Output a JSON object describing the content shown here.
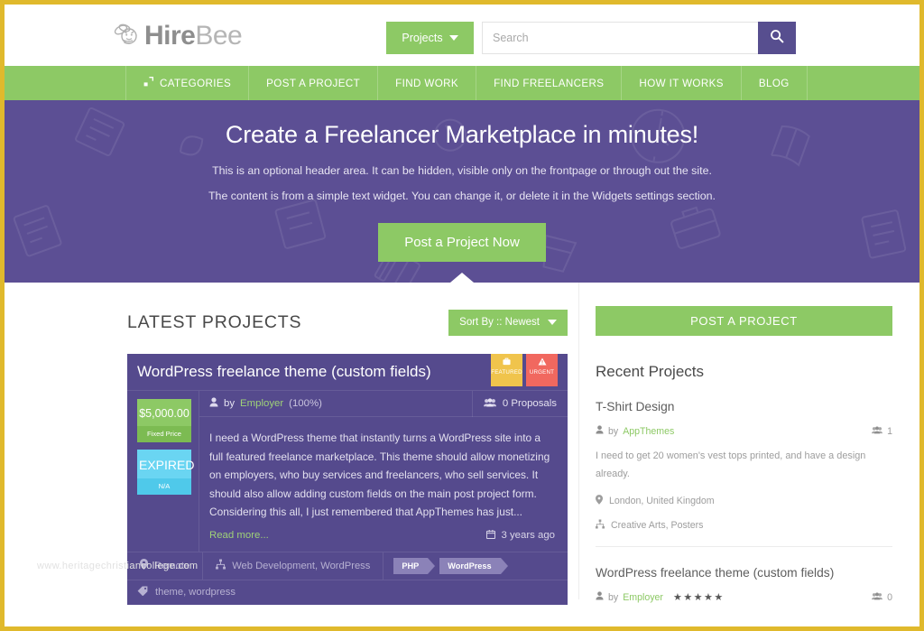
{
  "theme": {
    "page_border": "#e0b92c",
    "green": "#8dc965",
    "purple": "#5c4f94",
    "card_purple": "#554a8d",
    "search_btn": "#574e8f",
    "featured": "#f0c44c",
    "urgent": "#f1685f",
    "price_badge": "#8dc965",
    "status_badge": "#6ad5f2"
  },
  "header": {
    "logo_primary": "Hire",
    "logo_secondary": "Bee",
    "logo_icon": "bee-icon",
    "projects_dropdown": "Projects",
    "projects_caret_icon": "chevron-down-icon",
    "search_placeholder": "Search",
    "search_value": "",
    "search_icon": "search-icon"
  },
  "nav": {
    "items": [
      {
        "label": "CATEGORIES",
        "icon": "categories-icon"
      },
      {
        "label": "POST A PROJECT",
        "icon": ""
      },
      {
        "label": "FIND WORK",
        "icon": ""
      },
      {
        "label": "FIND FREELANCERS",
        "icon": ""
      },
      {
        "label": "HOW IT WORKS",
        "icon": ""
      },
      {
        "label": "BLOG",
        "icon": ""
      }
    ]
  },
  "hero": {
    "title": "Create a Freelancer Marketplace in minutes!",
    "line1": "This is an optional header area. It can be hidden, visible only on the frontpage or through out the site.",
    "line2": "The content is from a simple text widget. You can change it, or delete it in the Widgets settings section.",
    "button": "Post a Project Now"
  },
  "main": {
    "section_title": "LATEST PROJECTS",
    "sort_label": "Sort By :: Newest",
    "sort_caret_icon": "chevron-down-icon",
    "project": {
      "title": "WordPress freelance theme (custom fields)",
      "ribbons": [
        {
          "label": "FEATURED",
          "icon": "briefcase-icon"
        },
        {
          "label": "URGENT",
          "icon": "warning-icon"
        }
      ],
      "price": "$5,000.00",
      "price_type": "Fixed Price",
      "status": "EXPIRED",
      "status_sub": "N/A",
      "author_prefix": "by",
      "author": "Employer",
      "author_rating": "(100%)",
      "author_icon": "user-icon",
      "proposals": "0 Proposals",
      "proposals_icon": "users-icon",
      "description": "I need a WordPress theme that instantly turns a WordPress site into a full featured freelance marketplace. This theme should allow monetizing on employers, who buy services and freelancers, who sell services. It should also allow adding custom fields on the main post project form. Considering this all, I just remembered that AppThemes has just...",
      "read_more": "Read more...",
      "posted_ago": "3 years ago",
      "calendar_icon": "calendar-icon",
      "location": "Remote",
      "location_icon": "map-pin-icon",
      "categories": "Web Development, WordPress",
      "category_icon": "sitemap-icon",
      "skills": [
        "PHP",
        "WordPress"
      ],
      "tags": "theme, wordpress",
      "tags_icon": "tag-icon"
    }
  },
  "sidebar": {
    "post_button": "POST A PROJECT",
    "recent_title": "Recent Projects",
    "recent_projects": [
      {
        "name": "T-Shirt Design",
        "author_prefix": "by",
        "author": "AppThemes",
        "author_icon": "user-icon",
        "stars": "",
        "count": "1",
        "count_icon": "users-icon",
        "description": "I need to get 20 women's vest tops printed, and have a design already.",
        "location": "London, United Kingdom",
        "location_icon": "map-pin-icon",
        "categories": "Creative Arts, Posters",
        "category_icon": "sitemap-icon"
      },
      {
        "name": "WordPress freelance theme (custom fields)",
        "author_prefix": "by",
        "author": "Employer",
        "author_icon": "user-icon",
        "stars": "★★★★★",
        "count": "0",
        "count_icon": "users-icon",
        "description": "",
        "location": "",
        "location_icon": "",
        "categories": "",
        "category_icon": ""
      }
    ]
  },
  "watermark": "www.heritagechristiancollege.com"
}
